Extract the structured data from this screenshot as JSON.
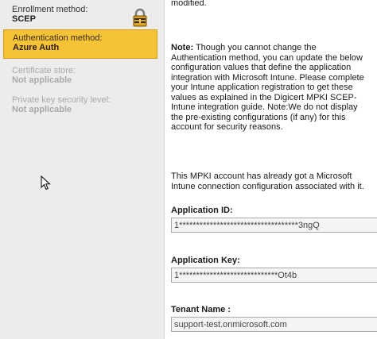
{
  "sidebar": {
    "enrollment": {
      "label": "Enrollment method:",
      "value": "SCEP"
    },
    "authentication": {
      "label": "Authentication method:",
      "value": "Azure Auth"
    },
    "certificate_store": {
      "label": "Certificate store:",
      "value": "Not applicable"
    },
    "private_key": {
      "label": "Private key security level:",
      "value": "Not applicable"
    }
  },
  "icons": {
    "lock": "lock-icon",
    "cursor": "mouse-pointer-icon"
  },
  "colors": {
    "selected_bg": "#f6c236",
    "selected_border": "#d99e0d",
    "sidebar_bg": "#ececec"
  },
  "content": {
    "top_text": "modified.",
    "note_heading": "Note:",
    "note_body": " Though you cannot change the Authentication method, you can update the below configuration values that define the application integration with Microsoft Intune. Please complete your Intune application registration to get these values as explained in the Digicert MPKI SCEP-Intune integration guide. Note:We do not display the pre-existing configurations (if any) for this account for security reasons.",
    "mpki_text": "This MPKI account has already got a Microsoft Intune connection configuration associated with it.",
    "fields": {
      "app_id": {
        "label": "Application ID:",
        "value": "1***********************************3ngQ"
      },
      "app_key": {
        "label": "Application Key:",
        "value": "1*****************************Ot4b"
      },
      "tenant": {
        "label": "Tenant Name :",
        "value": "support-test.onmicrosoft.com"
      }
    }
  }
}
